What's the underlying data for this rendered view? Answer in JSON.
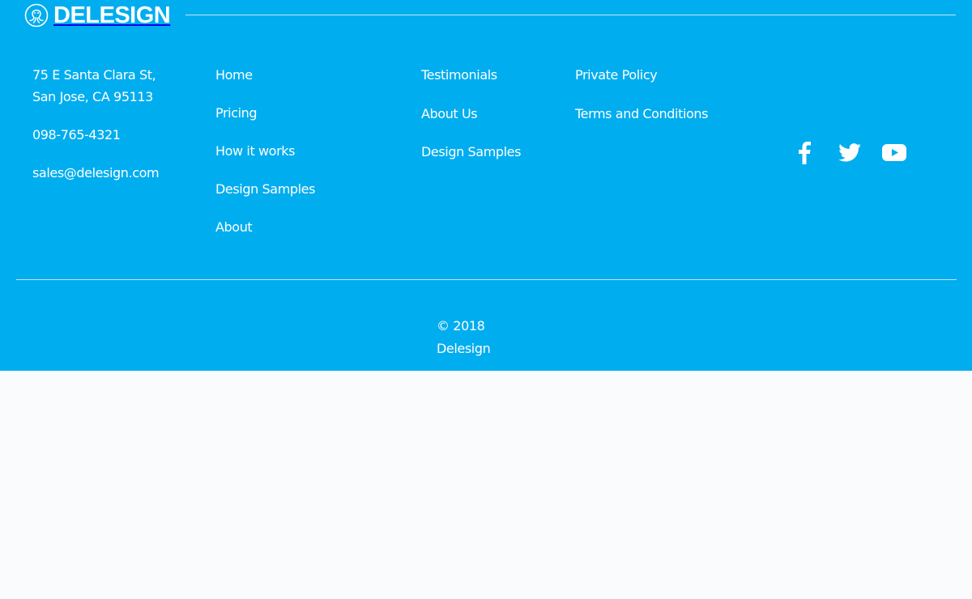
{
  "brand": {
    "name": "DELESIGN",
    "logo_icon": "octopus-logo-icon"
  },
  "contact": {
    "address_line1": "75 E Santa Clara St,",
    "address_line2": "San Jose, CA 95113",
    "phone": "098-765-4321",
    "email": "sales@delesign.com"
  },
  "nav_columns": [
    {
      "links": [
        "Home",
        "Pricing",
        "How it works",
        "Design Samples",
        "About"
      ]
    },
    {
      "links": [
        "Testimonials",
        "About Us",
        "Design Samples"
      ]
    },
    {
      "links": [
        "Private Policy",
        "Terms and Conditions"
      ]
    }
  ],
  "social": [
    {
      "icon": "facebook-icon"
    },
    {
      "icon": "twitter-icon"
    },
    {
      "icon": "youtube-icon"
    }
  ],
  "copyright": {
    "line1": "© 2018",
    "line2": "Delesign"
  },
  "colors": {
    "footer_bg": "#00adef",
    "text": "#ffffff",
    "page_bg": "#f9fbfc"
  }
}
